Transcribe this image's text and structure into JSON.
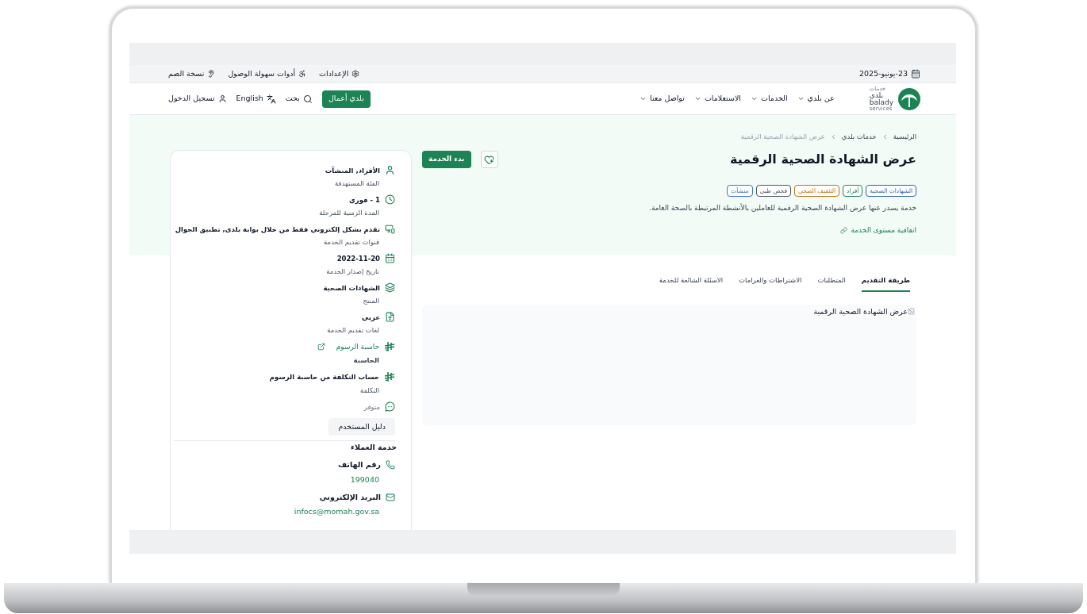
{
  "top_bar": {
    "date": "23-يونيو-2025",
    "links": [
      "الإعدادات",
      "أدوات سهولة الوصول",
      "نسخة الصم"
    ]
  },
  "nav": {
    "logo": {
      "arabic": "بلدي",
      "small": "خدمات",
      "latin": "balady",
      "tagline": "services"
    },
    "menu": [
      "عن بلدي",
      "الخدمات",
      "الاستعلامات",
      "تواصل معنا"
    ],
    "business_button": "بلدي أعمال",
    "search": "بحث",
    "language": "English",
    "login": "تسجيل الدخول"
  },
  "breadcrumb": [
    "الرئيسية",
    "خدمات بلدي",
    "عرض الشهادة الصحية الرقمية"
  ],
  "service": {
    "title": "عرض الشهادة الصحية الرقمية",
    "start_button": "بدء الخدمة",
    "tags": [
      {
        "label": "الشهادات الصحية",
        "color": "#2f5fb3"
      },
      {
        "label": "أفراد",
        "color": "#1b8354"
      },
      {
        "label": "التثقيف الصحي",
        "color": "#c2700c"
      },
      {
        "label": "فحص طبي",
        "color": "#4b5563"
      },
      {
        "label": "منشآت",
        "color": "#3b6fd1"
      }
    ],
    "description": "خدمة يصدر عنها عرض الشهادة الصحية الرقمية للعاملين بالأنشطة المرتبطة بالصحة العامة.",
    "sla_link": "اتفاقية مستوى الخدمة"
  },
  "tabs": [
    {
      "label": "طريقة التقديم",
      "selected": true
    },
    {
      "label": "المتطلبات",
      "selected": false
    },
    {
      "label": "الاشتراطات والغرامات",
      "selected": false
    },
    {
      "label": "الاسئلة الشائعة للخدمة",
      "selected": false
    }
  ],
  "tab_content": {
    "image_alt": "عرض الشهادة الصحية الرقمية"
  },
  "sidebar": {
    "items": [
      {
        "kind": "info",
        "value": "الأفراد, المنشآت",
        "label": "الفئة المستهدفة"
      },
      {
        "kind": "info",
        "value": "1 - فوري",
        "label": "المدة الزمنية للمرحلة"
      },
      {
        "kind": "info",
        "value": "تقدم بشكل إلكتروني فقط من خلال بوابة بلدى, تطبيق الجوال",
        "label": "قنوات تقديم الخدمة"
      },
      {
        "kind": "info",
        "value": "2022-11-20",
        "label": "تاريخ إصدار الخدمة"
      },
      {
        "kind": "info",
        "value": "الشهادات الصحية",
        "label": "المنتج"
      },
      {
        "kind": "info",
        "value": "عربي",
        "label": "لغات تقديم الخدمة"
      },
      {
        "kind": "link",
        "value": "حاسبة الرسوم",
        "label": "الحاسبة"
      },
      {
        "kind": "info",
        "value": "حساب التكلفة من حاسبة الرسوم",
        "label": "التكلفة"
      },
      {
        "kind": "status",
        "value": "متوفر"
      }
    ],
    "guide_button": "دليل المستخدم",
    "customer_service": {
      "heading": "خدمة العملاء",
      "contacts": [
        {
          "label": "رقم الهاتف",
          "value": "199040"
        },
        {
          "label": "البريد الإلكتروني",
          "value": "infocs@momah.gov.sa"
        }
      ]
    }
  }
}
